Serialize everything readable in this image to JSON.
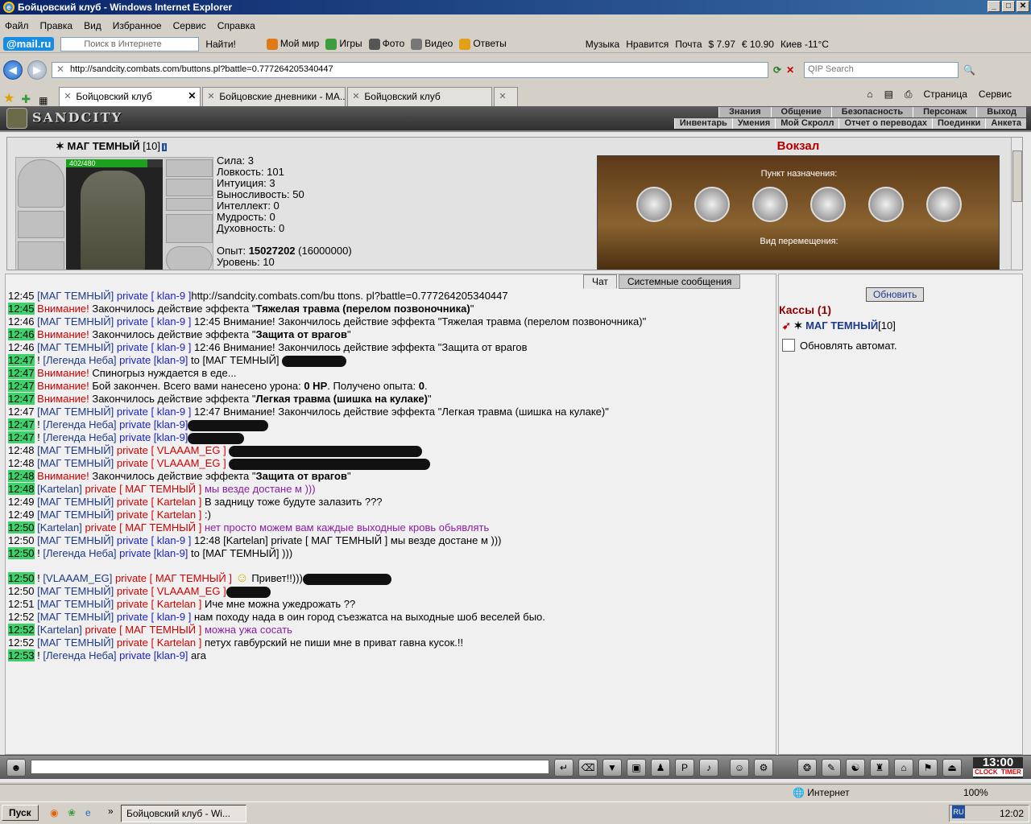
{
  "window": {
    "title": "Бойцовский клуб - Windows Internet Explorer"
  },
  "menu": [
    "Файл",
    "Правка",
    "Вид",
    "Избранное",
    "Сервис",
    "Справка"
  ],
  "mailbar": {
    "logo": "@mail.ru",
    "search_placeholder": "Поиск в Интернете",
    "search_button": "Найти!",
    "links": [
      "Мой мир",
      "Игры",
      "Фото",
      "Видео",
      "Ответы"
    ],
    "right": [
      "Музыка",
      "Нравится",
      "Почта",
      "$ 7.97",
      "€ 10.90",
      "Киев -11°C"
    ]
  },
  "address": {
    "url": "http://sandcity.combats.com/buttons.pl?battle=0.777264205340447",
    "qip_placeholder": "QIP Search"
  },
  "tabs": [
    {
      "label": "Бойцовский клуб",
      "active": true
    },
    {
      "label": "Бойцовские дневники - МА...",
      "active": false
    },
    {
      "label": "Бойцовский клуб",
      "active": false
    }
  ],
  "ie_tools": {
    "page": "Страница",
    "service": "Сервис"
  },
  "game": {
    "logo": "SANDCITY",
    "topnav": [
      "Знания",
      "Общение",
      "Безопасность",
      "Персонаж",
      "Выход"
    ],
    "subnav": [
      "Инвентарь",
      "Умения",
      "Мой Скролл",
      "Отчет о переводах",
      "Поединки",
      "Анкета"
    ],
    "character": {
      "name": "МАГ ТЕМНЫЙ",
      "level": "[10]",
      "info": "i",
      "hp_text": "402/480",
      "hp_fraction": 0.8375,
      "stats": [
        "Сила: 3",
        "Ловкость: 101",
        "Интуиция: 3",
        "Выносливость: 50",
        "Интеллект: 0",
        "Мудрость: 0",
        "Духовность: 0"
      ],
      "exp_label": "Опыт:",
      "exp_value": "15027202",
      "exp_next": "(16000000)",
      "level_line": "Уровень: 10"
    },
    "location": {
      "title": "Вокзал",
      "destination_label": "Пункт назначения:",
      "travel_label": "Вид перемещения:"
    },
    "chat_tabs": [
      "Чат",
      "Системные сообщения"
    ],
    "right": {
      "refresh": "Обновить",
      "kassy": "Кассы (1)",
      "kassa_user": "МАГ ТЕМНЫЙ",
      "kassa_level": "[10]",
      "auto": "Обновлять автомат."
    },
    "clock": {
      "time": "13:00",
      "left": "CLOCK",
      "right": "TIMER"
    }
  },
  "chat": [
    {
      "t": "12:45",
      "hl": false,
      "parts": [
        [
          "n",
          "[МАГ ТЕМНЫЙ]"
        ],
        [
          "pb",
          " private [ klan-9 ]"
        ],
        [
          "",
          ""
        ],
        [
          "",
          "http://sandcity.combats.com/bu ttons. pl?battle=0.777264205340447"
        ]
      ]
    },
    {
      "t": "12:45",
      "hl": true,
      "parts": [
        [
          "warn",
          "Внимание!"
        ],
        [
          "",
          " Закончилось действие эффекта \""
        ],
        [
          "b",
          "Тяжелая травма (перелом позвоночника)"
        ],
        [
          "",
          "\""
        ]
      ]
    },
    {
      "t": "12:46",
      "hl": false,
      "parts": [
        [
          "n",
          "[МАГ ТЕМНЫЙ]"
        ],
        [
          "pb",
          " private [ klan-9 ]"
        ],
        [
          "",
          " 12:45 Внимание! Закончилось действие эффекта \"Тяжелая травма (перелом позвоночника)\""
        ]
      ]
    },
    {
      "t": "12:46",
      "hl": true,
      "parts": [
        [
          "warn",
          "Внимание!"
        ],
        [
          "",
          " Закончилось действие эффекта \""
        ],
        [
          "b",
          "Защита от врагов"
        ],
        [
          "",
          "\""
        ]
      ]
    },
    {
      "t": "12:46",
      "hl": false,
      "parts": [
        [
          "n",
          "[МАГ ТЕМНЫЙ]"
        ],
        [
          "pb",
          " private [ klan-9 ]"
        ],
        [
          "",
          " 12:46 Внимание! Закончилось действие эффекта \"Защита от врагов"
        ]
      ]
    },
    {
      "t": "12:47",
      "hl": true,
      "parts": [
        [
          "",
          "! "
        ],
        [
          "n",
          "[Легенда Неба]"
        ],
        [
          "pb",
          " private [klan-9]"
        ],
        [
          "",
          " to [МАГ ТЕМНЫЙ] "
        ],
        [
          "blot80",
          ""
        ]
      ]
    },
    {
      "t": "12:47",
      "hl": true,
      "parts": [
        [
          "warn",
          "Внимание!"
        ],
        [
          "",
          " Спиногрыз нуждается в еде..."
        ]
      ]
    },
    {
      "t": "12:47",
      "hl": true,
      "parts": [
        [
          "warn",
          "Внимание!"
        ],
        [
          "",
          " Бой закончен. Всего вами нанесено урона: "
        ],
        [
          "b",
          "0 HP"
        ],
        [
          "",
          ". Получено опыта: "
        ],
        [
          "b",
          "0"
        ],
        [
          "",
          "."
        ]
      ]
    },
    {
      "t": "12:47",
      "hl": true,
      "parts": [
        [
          "warn",
          "Внимание!"
        ],
        [
          "",
          " Закончилось действие эффекта \""
        ],
        [
          "b",
          "Легкая травма (шишка на кулаке)"
        ],
        [
          "",
          "\""
        ]
      ]
    },
    {
      "t": "12:47",
      "hl": false,
      "parts": [
        [
          "n",
          "[МАГ ТЕМНЫЙ]"
        ],
        [
          "pb",
          " private [ klan-9 ]"
        ],
        [
          "",
          " 12:47 Внимание! Закончилось действие эффекта \"Легкая травма (шишка на кулаке)\""
        ]
      ]
    },
    {
      "t": "12:47",
      "hl": true,
      "parts": [
        [
          "",
          "! "
        ],
        [
          "n",
          "[Легенда Неба]"
        ],
        [
          "pb",
          " private [klan-9]"
        ],
        [
          "blot100",
          ""
        ]
      ]
    },
    {
      "t": "12:47",
      "hl": true,
      "parts": [
        [
          "",
          "! "
        ],
        [
          "n",
          "[Легенда Неба]"
        ],
        [
          "pb",
          " private [klan-9]"
        ],
        [
          "blot70",
          ""
        ]
      ]
    },
    {
      "t": "12:48",
      "hl": false,
      "parts": [
        [
          "n",
          "[МАГ ТЕМНЫЙ]"
        ],
        [
          "pr",
          " private [ VLAAAM_EG ]"
        ],
        [
          "",
          " "
        ],
        [
          "blot240",
          ""
        ]
      ]
    },
    {
      "t": "12:48",
      "hl": false,
      "parts": [
        [
          "n",
          "[МАГ ТЕМНЫЙ]"
        ],
        [
          "pr",
          " private [ VLAAAM_EG ]"
        ],
        [
          "",
          " "
        ],
        [
          "blot250",
          ""
        ]
      ]
    },
    {
      "t": "12:48",
      "hl": true,
      "parts": [
        [
          "warn",
          "Внимание!"
        ],
        [
          "",
          " Закончилось действие эффекта \""
        ],
        [
          "b",
          "Защита от врагов"
        ],
        [
          "",
          "\""
        ]
      ]
    },
    {
      "t": "12:48",
      "hl": true,
      "parts": [
        [
          "n",
          "[Kartelan]"
        ],
        [
          "pr",
          " private [ МАГ ТЕМНЫЙ ]"
        ],
        [
          "purple",
          " мы везде достане м )))"
        ]
      ]
    },
    {
      "t": "12:49",
      "hl": false,
      "parts": [
        [
          "n",
          "[МАГ ТЕМНЫЙ]"
        ],
        [
          "pr",
          " private [ Kartelan ]"
        ],
        [
          "",
          " В задницу тоже будуте залазить ???"
        ]
      ]
    },
    {
      "t": "12:49",
      "hl": false,
      "parts": [
        [
          "n",
          "[МАГ ТЕМНЫЙ]"
        ],
        [
          "pr",
          " private [ Kartelan ]"
        ],
        [
          "",
          " :)"
        ]
      ]
    },
    {
      "t": "12:50",
      "hl": true,
      "parts": [
        [
          "n",
          "[Kartelan]"
        ],
        [
          "pr",
          " private [ МАГ ТЕМНЫЙ ]"
        ],
        [
          "purple",
          " нет просто можем вам каждые выходные кровь обьявлять"
        ]
      ]
    },
    {
      "t": "12:50",
      "hl": false,
      "parts": [
        [
          "n",
          "[МАГ ТЕМНЫЙ]"
        ],
        [
          "pb",
          " private [ klan-9 ]"
        ],
        [
          "",
          " 12:48 [Kartelan] private [ МАГ ТЕМНЫЙ ] мы везде достане м )))"
        ]
      ]
    },
    {
      "t": "12:50",
      "hl": true,
      "parts": [
        [
          "",
          "! "
        ],
        [
          "n",
          "[Легенда Неба]"
        ],
        [
          "pb",
          " private [klan-9]"
        ],
        [
          "",
          " to [МАГ ТЕМНЫЙ] )))"
        ]
      ]
    },
    {
      "t": "12:50",
      "hl": true,
      "gap": true,
      "parts": [
        [
          "",
          "! "
        ],
        [
          "n",
          "[VLAAAM_EG]"
        ],
        [
          "pr",
          " private [ МАГ ТЕМНЫЙ ]"
        ],
        [
          "smile",
          ""
        ],
        [
          "",
          " Привет!!)))"
        ],
        [
          "blot110",
          ""
        ]
      ]
    },
    {
      "t": "12:50",
      "hl": false,
      "parts": [
        [
          "n",
          "[МАГ ТЕМНЫЙ]"
        ],
        [
          "pr",
          " private [ VLAAAM_EG ]"
        ],
        [
          "blot55",
          ""
        ]
      ]
    },
    {
      "t": "12:51",
      "hl": false,
      "parts": [
        [
          "n",
          "[МАГ ТЕМНЫЙ]"
        ],
        [
          "pr",
          " private [ Kartelan ]"
        ],
        [
          "",
          " Иче мне можна ужедрожать ??"
        ]
      ]
    },
    {
      "t": "12:52",
      "hl": false,
      "parts": [
        [
          "n",
          "[МАГ ТЕМНЫЙ]"
        ],
        [
          "pb",
          " private [ klan-9 ]"
        ],
        [
          "",
          " нам походу нада в оин город съезжатса на выходные шоб веселей быо."
        ]
      ]
    },
    {
      "t": "12:52",
      "hl": true,
      "parts": [
        [
          "n",
          "[Kartelan]"
        ],
        [
          "pr",
          " private [ МАГ ТЕМНЫЙ ]"
        ],
        [
          "purple",
          " можна ужа сосать"
        ]
      ]
    },
    {
      "t": "12:52",
      "hl": false,
      "parts": [
        [
          "n",
          "[МАГ ТЕМНЫЙ]"
        ],
        [
          "pr",
          " private [ Kartelan ]"
        ],
        [
          "",
          " петух гавбурский не пиши мне в приват гавна кусок.!!"
        ]
      ]
    },
    {
      "t": "12:53",
      "hl": true,
      "parts": [
        [
          "",
          "! "
        ],
        [
          "n",
          "[Легенда Неба]"
        ],
        [
          "pb",
          " private [klan-9]"
        ],
        [
          "",
          " ага"
        ]
      ]
    }
  ],
  "status": {
    "zone": "Интернет",
    "zoom": "100%"
  },
  "taskbar": {
    "start": "Пуск",
    "task": "Бойцовский клуб - Wi...",
    "lang": "RU",
    "time": "12:02"
  }
}
